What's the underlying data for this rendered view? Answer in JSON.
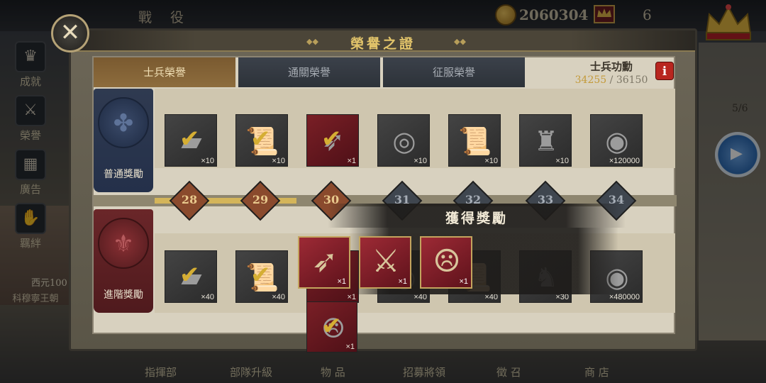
{
  "background": {
    "title": "戰  役",
    "coins": "2060304",
    "crowns": "6",
    "stage_count": "5/6",
    "left_label": "科穆寧王朝",
    "left_year": "西元100",
    "side_nav": [
      {
        "label": "成就",
        "icon": "trophy-icon"
      },
      {
        "label": "榮譽",
        "icon": "sword-icon"
      },
      {
        "label": "廣告",
        "icon": "film-icon"
      },
      {
        "label": "羈絆",
        "icon": "handshake-icon"
      }
    ],
    "bottom_nav": [
      "指揮部",
      "部隊升級",
      "物  品",
      "招募將領",
      "徵  召",
      "商  店"
    ]
  },
  "dialog": {
    "title": "榮譽之證",
    "tabs": [
      {
        "label": "士兵榮譽",
        "active": true
      },
      {
        "label": "通關榮譽",
        "active": false
      },
      {
        "label": "征服榮譽",
        "active": false
      }
    ],
    "merit_label": "士兵功勳",
    "merit_current": "34255",
    "merit_separator": "/",
    "merit_total": "36150",
    "info": "i",
    "normal_label": "普通獎勵",
    "advanced_label": "進階獎勵",
    "levels": [
      {
        "num": "28",
        "done": true
      },
      {
        "num": "29",
        "done": true
      },
      {
        "num": "30",
        "done": true
      },
      {
        "num": "31",
        "done": false
      },
      {
        "num": "32",
        "done": false
      },
      {
        "num": "33",
        "done": false
      },
      {
        "num": "34",
        "done": false
      }
    ],
    "normal_rewards": [
      {
        "icon": "iron-ingot-icon",
        "glyph": "▰",
        "qty": "×10",
        "claimed": true,
        "red": false
      },
      {
        "icon": "scroll-icon",
        "glyph": "📜",
        "qty": "×10",
        "claimed": true,
        "red": false
      },
      {
        "icon": "bow-icon",
        "glyph": "➶",
        "qty": "×1",
        "claimed": true,
        "red": true
      },
      {
        "icon": "drum-icon",
        "glyph": "◎",
        "qty": "×10",
        "claimed": false,
        "red": false
      },
      {
        "icon": "scroll-icon",
        "glyph": "📜",
        "qty": "×10",
        "claimed": false,
        "red": false
      },
      {
        "icon": "soldier-icon",
        "glyph": "♜",
        "qty": "×10",
        "claimed": false,
        "red": false
      },
      {
        "icon": "coins-icon",
        "glyph": "◉",
        "qty": "×120000",
        "claimed": false,
        "red": false
      }
    ],
    "advanced_rewards": [
      {
        "icon": "iron-ingot-icon",
        "glyph": "▰",
        "qty": "×40",
        "claimed": true,
        "red": false
      },
      {
        "icon": "scroll-icon",
        "glyph": "📜",
        "qty": "×40",
        "claimed": true,
        "red": false
      },
      {
        "icon": "sword-icon",
        "glyph": "⚔",
        "qty": "×1",
        "claimed": true,
        "red": true
      },
      {
        "icon": "drum-icon",
        "glyph": "◎",
        "qty": "×40",
        "claimed": false,
        "red": false
      },
      {
        "icon": "scroll-icon",
        "glyph": "📜",
        "qty": "×40",
        "claimed": false,
        "red": false
      },
      {
        "icon": "knight-icon",
        "glyph": "♞",
        "qty": "×30",
        "claimed": false,
        "red": false
      },
      {
        "icon": "coins-icon",
        "glyph": "◉",
        "qty": "×480000",
        "claimed": false,
        "red": false
      }
    ],
    "extra_reward": {
      "icon": "mask-icon",
      "glyph": "☹",
      "qty": "×1",
      "claimed": true
    }
  },
  "popup": {
    "title": "獲得獎勵",
    "rewards": [
      {
        "icon": "bow-icon",
        "glyph": "➶",
        "qty": "×1"
      },
      {
        "icon": "sword-icon",
        "glyph": "⚔",
        "qty": "×1"
      },
      {
        "icon": "mask-icon",
        "glyph": "☹",
        "qty": "×1"
      }
    ]
  },
  "colors": {
    "gold": "#d5ae33",
    "active_tab": "#8d6c3d",
    "inactive_tab": "#2d3239",
    "info_red": "#b8261f"
  }
}
